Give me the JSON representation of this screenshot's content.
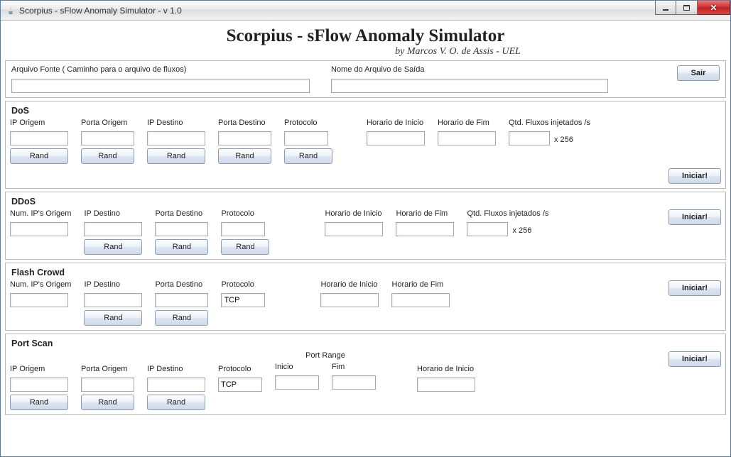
{
  "window": {
    "title": "Scorpius - sFlow Anomaly Simulator - v 1.0"
  },
  "header": {
    "title": "Scorpius - sFlow Anomaly Simulator",
    "subtitle": "by Marcos V. O. de Assis - UEL"
  },
  "topPanel": {
    "sourceLabel": "Arquivo Fonte ( Caminho para o arquivo de fluxos)",
    "sourceValue": "",
    "outLabel": "Nome do Arquivo de Saída",
    "outValue": "",
    "exitLabel": "Sair"
  },
  "common": {
    "rand": "Rand",
    "iniciar": "Iniciar!",
    "x256": "x 256"
  },
  "dos": {
    "title": "DoS",
    "cols": {
      "ipOrigem": "IP Origem",
      "portaOrigem": "Porta Origem",
      "ipDestino": "IP Destino",
      "portaDestino": "Porta Destino",
      "protocolo": "Protocolo",
      "hInicio": "Horario de Inicio",
      "hFim": "Horario de Fim",
      "qtd": "Qtd. Fluxos injetados /s"
    },
    "vals": {
      "ipOrigem": "",
      "portaOrigem": "",
      "ipDestino": "",
      "portaDestino": "",
      "protocolo": "",
      "hInicio": "",
      "hFim": "",
      "qtd": ""
    }
  },
  "ddos": {
    "title": "DDoS",
    "cols": {
      "numIps": "Num. IP's Origem",
      "ipDestino": "IP Destino",
      "portaDestino": "Porta Destino",
      "protocolo": "Protocolo",
      "hInicio": "Horario de Inicio",
      "hFim": "Horario de Fim",
      "qtd": "Qtd. Fluxos injetados /s"
    },
    "vals": {
      "numIps": "",
      "ipDestino": "",
      "portaDestino": "",
      "protocolo": "",
      "hInicio": "",
      "hFim": "",
      "qtd": ""
    }
  },
  "flash": {
    "title": "Flash Crowd",
    "cols": {
      "numIps": "Num. IP's Origem",
      "ipDestino": "IP Destino",
      "portaDestino": "Porta Destino",
      "protocolo": "Protocolo",
      "hInicio": "Horario de Inicio",
      "hFim": "Horario de Fim"
    },
    "vals": {
      "numIps": "",
      "ipDestino": "",
      "portaDestino": "",
      "protocolo": "TCP",
      "hInicio": "",
      "hFim": ""
    }
  },
  "portscan": {
    "title": "Port Scan",
    "cols": {
      "ipOrigem": "IP Origem",
      "portaOrigem": "Porta Origem",
      "ipDestino": "IP Destino",
      "protocolo": "Protocolo",
      "portRange": "Port Range",
      "inicio": "Inicio",
      "fim": "Fim",
      "hInicio": "Horario de Inicio"
    },
    "vals": {
      "ipOrigem": "",
      "portaOrigem": "",
      "ipDestino": "",
      "protocolo": "TCP",
      "inicio": "",
      "fim": "",
      "hInicio": ""
    }
  }
}
